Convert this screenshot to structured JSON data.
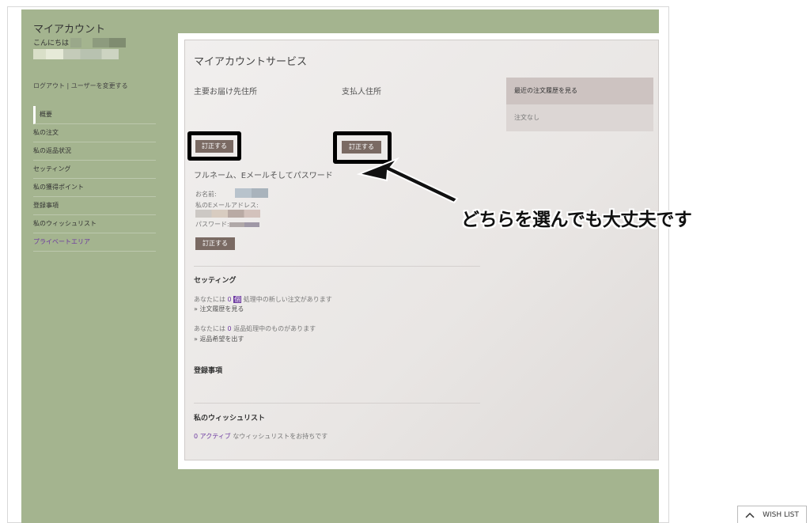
{
  "sidebar": {
    "title": "マイアカウント",
    "greeting": "こんにちは",
    "logout": "ログアウト",
    "separator": " | ",
    "change_user": "ユーザーを変更する",
    "items": [
      {
        "label": "概要"
      },
      {
        "label": "私の注文"
      },
      {
        "label": "私の返品状況"
      },
      {
        "label": "セッティング"
      },
      {
        "label": "私の獲得ポイント"
      },
      {
        "label": "登録事項"
      },
      {
        "label": "私のウィッシュリスト"
      },
      {
        "label": "プライベートエリア"
      }
    ]
  },
  "main": {
    "title": "マイアカウントサービス",
    "shipping_label": "主要お届け先住所",
    "billing_label": "支払人住所",
    "edit_label": "訂正する",
    "account_title": "フルネーム、Eメールそしてパスワード",
    "name_label": "お名前:",
    "email_label": "私のEメールアドレス:",
    "password_label": "パスワード:",
    "settings_title": "セッティング",
    "orders_prefix": "あなたには",
    "orders_count": "0",
    "orders_badge": "個",
    "orders_suffix": "処理中の新しい注文があります",
    "orders_link": "» 注文履歴を見る",
    "returns_prefix": "あなたには",
    "returns_count": "0",
    "returns_suffix": "返品処理中のものがあります",
    "returns_link": "» 返品希望を出す",
    "registration_title": "登録事項",
    "wishlist_title": "私のウィッシュリスト",
    "wishlist_active": "0 アクティブ",
    "wishlist_suffix": "なウィッシュリストをお持ちです"
  },
  "recent_orders": {
    "title": "最近の注文履歴を見る",
    "empty": "注文なし"
  },
  "annotation": {
    "text": "どちらを選んでも大丈夫です"
  },
  "wishlist_tab": {
    "label": "WISH LIST"
  },
  "colors": {
    "green_bg": "#a4b48f",
    "button": "#7a6a63",
    "link_purple": "#6d3aa0"
  }
}
